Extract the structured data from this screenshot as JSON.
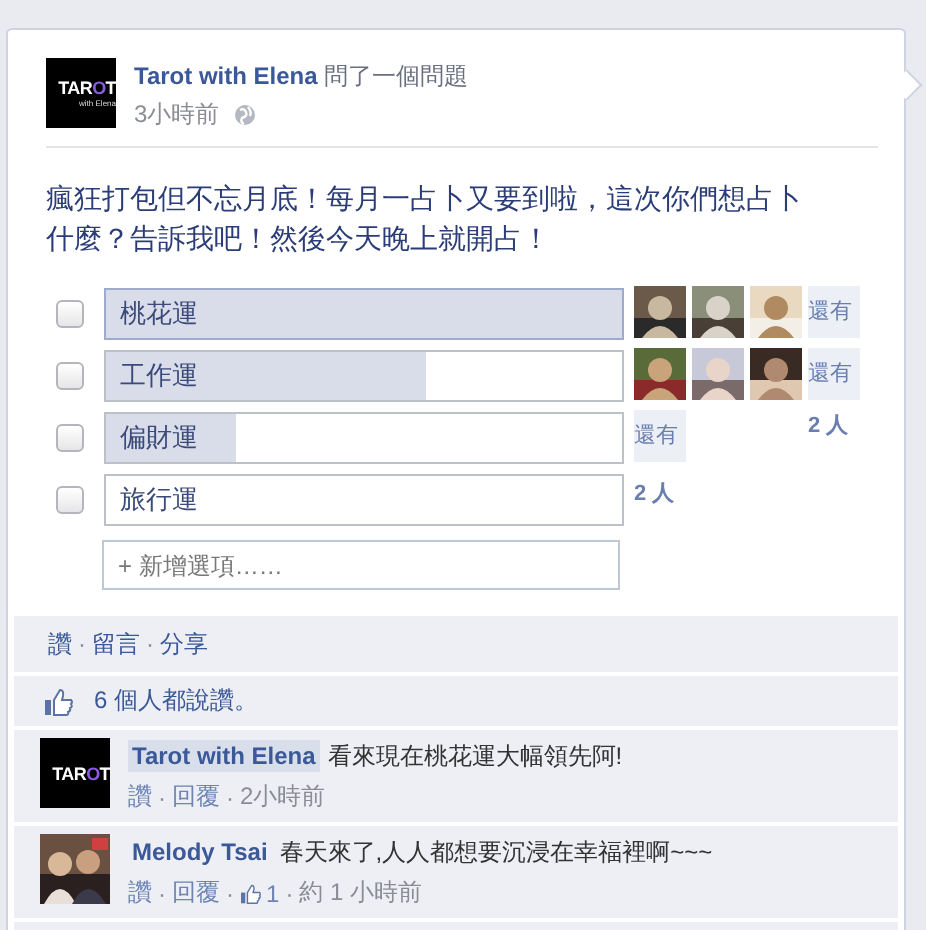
{
  "post": {
    "author": "Tarot with Elena",
    "action": "問了一個問題",
    "time": "3小時前",
    "logo": {
      "before": "TAR",
      "accent": "O",
      "after": "T",
      "sub": "with Elena"
    },
    "text": "瘋狂打包但不忘月底！每月一占卜又要到啦，這次你們想占卜什麼？告訴我吧！然後今天晚上就開占！"
  },
  "options": [
    {
      "label": "桃花運",
      "checked": false,
      "level": 1.0,
      "voters": [
        {
          "kind": "picture"
        },
        {
          "kind": "picture"
        },
        {
          "kind": "picture"
        },
        {
          "kind": "more",
          "text": "還有"
        }
      ]
    },
    {
      "label": "工作運",
      "checked": false,
      "level": 0.62,
      "voters": [
        {
          "kind": "picture"
        },
        {
          "kind": "picture"
        },
        {
          "kind": "picture"
        },
        {
          "kind": "more",
          "text": "還有"
        },
        {
          "kind": "count",
          "text": "2 人"
        }
      ]
    },
    {
      "label": "偏財運",
      "checked": false,
      "level": 0.25,
      "voters": [
        {
          "kind": "more",
          "text": "還有"
        }
      ]
    },
    {
      "label": "旅行運",
      "checked": false,
      "voters": [
        {
          "kind": "count",
          "text": "2 人"
        }
      ]
    }
  ],
  "add_option": {
    "placeholder": "+ 新增選項……"
  },
  "actions": [
    {
      "kind": "link",
      "text": "讚"
    },
    {
      "kind": "sep",
      "text": "·"
    },
    {
      "kind": "link",
      "text": "留言"
    },
    {
      "kind": "sep",
      "text": "·"
    },
    {
      "kind": "link",
      "text": "分享"
    }
  ],
  "likes": "6 個人都說讚。",
  "comments": [
    {
      "author": "Tarot with Elena",
      "highlighted": true,
      "avatar": {
        "kind": "logo",
        "before": "TAR",
        "accent": "O",
        "after": "T"
      },
      "text": "看來現在桃花運大幅領先阿!",
      "meta": [
        {
          "kind": "link",
          "text": "讚"
        },
        {
          "kind": "sep",
          "text": "·"
        },
        {
          "kind": "link",
          "text": "回覆"
        },
        {
          "kind": "sep",
          "text": "·"
        },
        {
          "kind": "time",
          "text": "2小時前"
        }
      ]
    },
    {
      "author": "Melody Tsai",
      "highlighted": false,
      "avatar": {
        "kind": "picture"
      },
      "text": "春天來了,人人都想要沉浸在幸福裡啊~~~",
      "meta": [
        {
          "kind": "link",
          "text": "讚"
        },
        {
          "kind": "sep",
          "text": "·"
        },
        {
          "kind": "link",
          "text": "回覆"
        },
        {
          "kind": "sep",
          "text": "·"
        },
        {
          "kind": "likes",
          "text": "1"
        },
        {
          "kind": "sep",
          "text": "·"
        },
        {
          "kind": "time",
          "text": "約 1 小時前"
        }
      ]
    }
  ]
}
